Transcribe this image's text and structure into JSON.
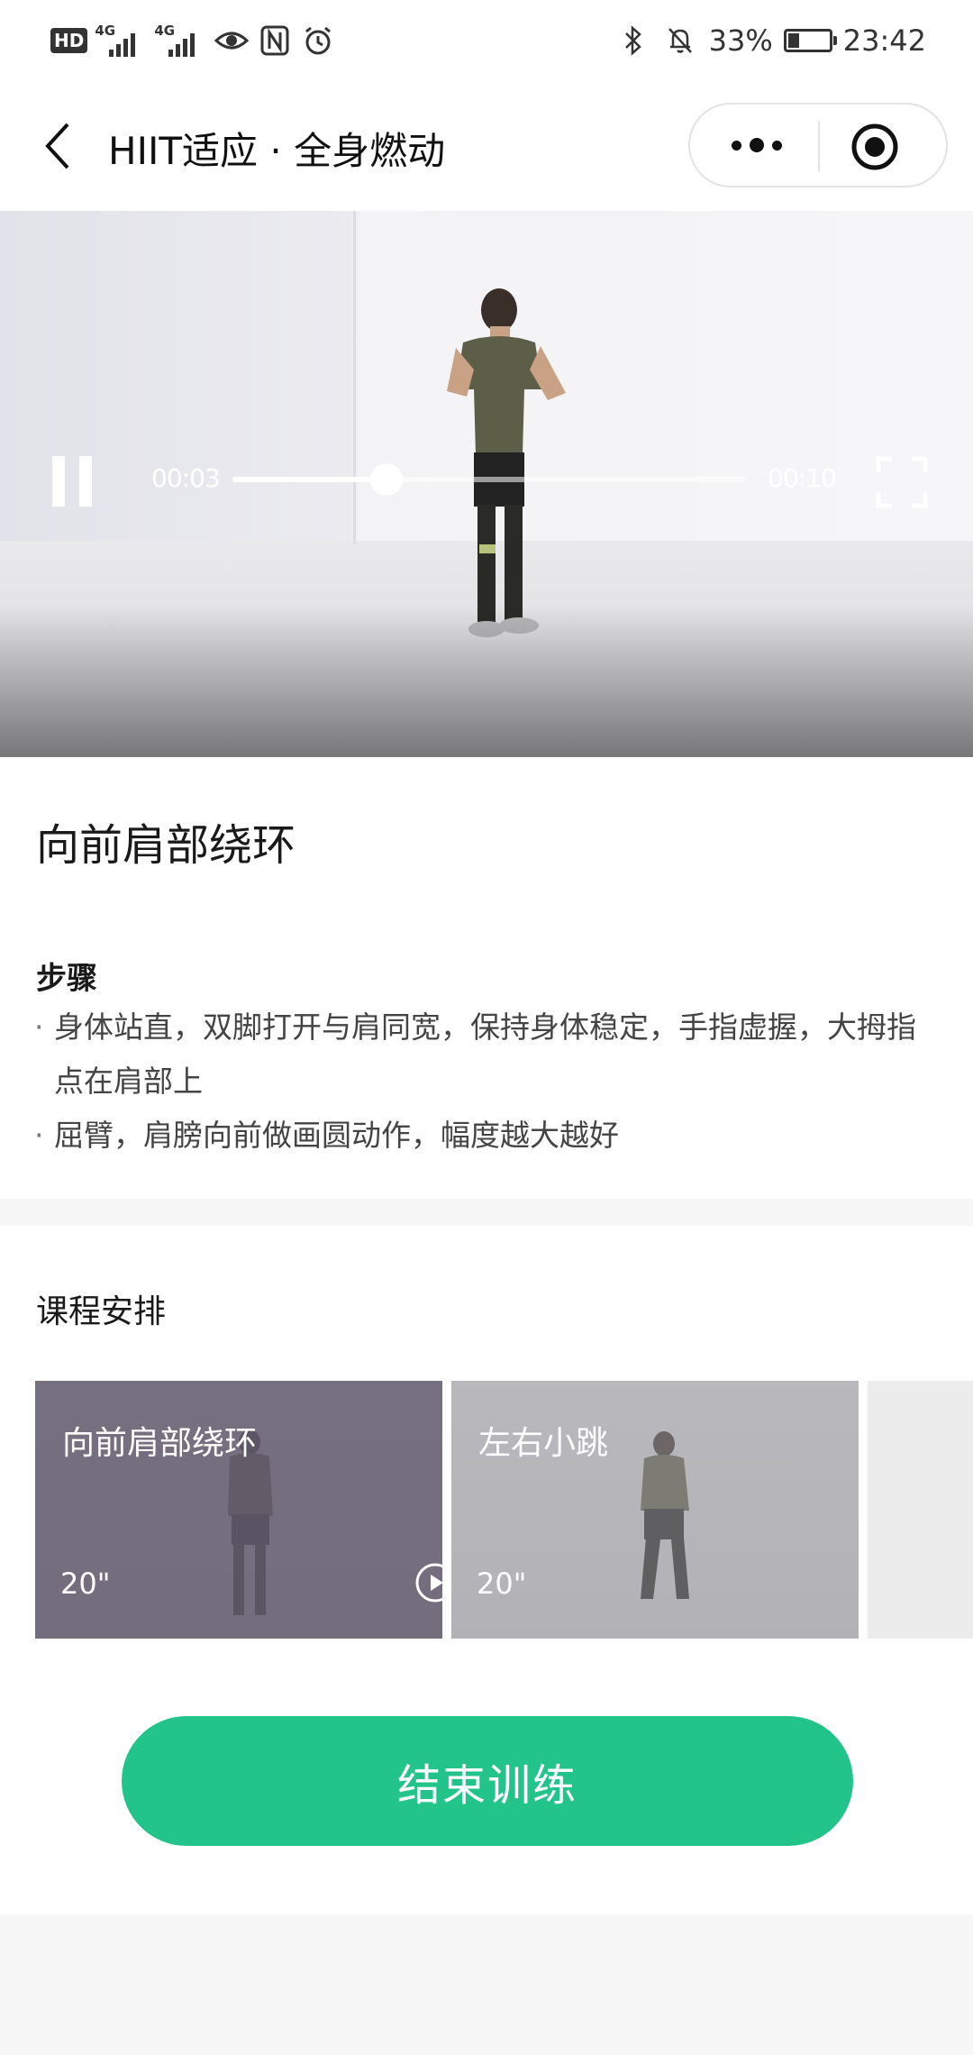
{
  "status_bar": {
    "hd_label": "HD",
    "network_1": "4G",
    "network_2": "4G",
    "battery_percent": "33%",
    "battery_level": 0.33,
    "time": "23:42",
    "icons": [
      "eye-comfort-icon",
      "nfc-icon",
      "alarm-icon",
      "bluetooth-icon",
      "bell-muted-icon",
      "battery-icon"
    ]
  },
  "nav": {
    "title": "HIIT适应 · 全身燃动",
    "back_icon": "chevron-left-icon",
    "more_icon": "more-dots-icon",
    "close_icon": "miniprogram-close-icon"
  },
  "video": {
    "current_time": "00:03",
    "total_time": "00:10",
    "progress": 0.3,
    "pause_icon": "pause-icon",
    "fullscreen_icon": "fullscreen-icon"
  },
  "exercise": {
    "title": "向前肩部绕环",
    "steps_heading": "步骤",
    "steps": [
      "身体站直，双脚打开与肩同宽，保持身体稳定，手指虚握，大拇指点在肩部上",
      "屈臂，肩膀向前做画圆动作，幅度越大越好"
    ]
  },
  "schedule": {
    "title": "课程安排",
    "cards": [
      {
        "label": "向前肩部绕环",
        "duration": "20\"",
        "current": true,
        "icon": "play-circle-icon"
      },
      {
        "label": "左右小跳",
        "duration": "20\"",
        "current": false
      }
    ]
  },
  "finish_button_label": "结束训练",
  "colors": {
    "accent": "#22c48a",
    "active_card_overlay": "#736c7c",
    "inactive_card_overlay": "#a9a9ad"
  }
}
